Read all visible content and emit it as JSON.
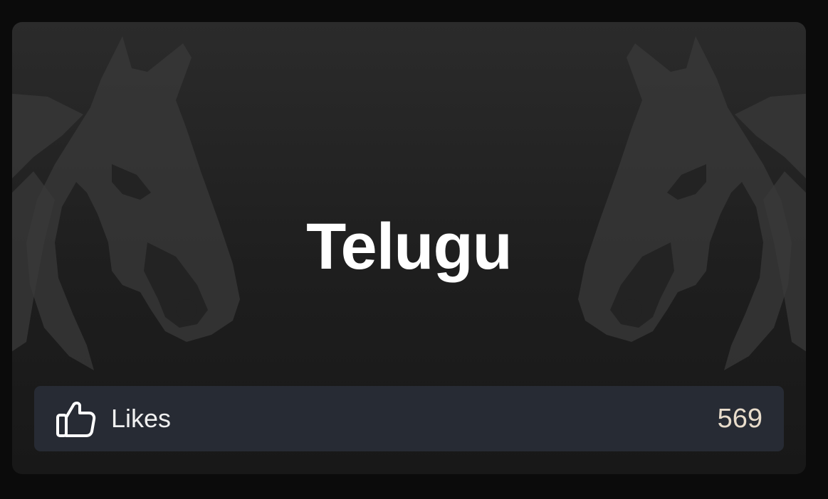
{
  "card": {
    "title": "Telugu",
    "icons": {
      "left": "horse-head-icon",
      "right": "horse-head-icon"
    }
  },
  "likes": {
    "icon": "thumbs-up-icon",
    "label": "Likes",
    "count": "569"
  }
}
